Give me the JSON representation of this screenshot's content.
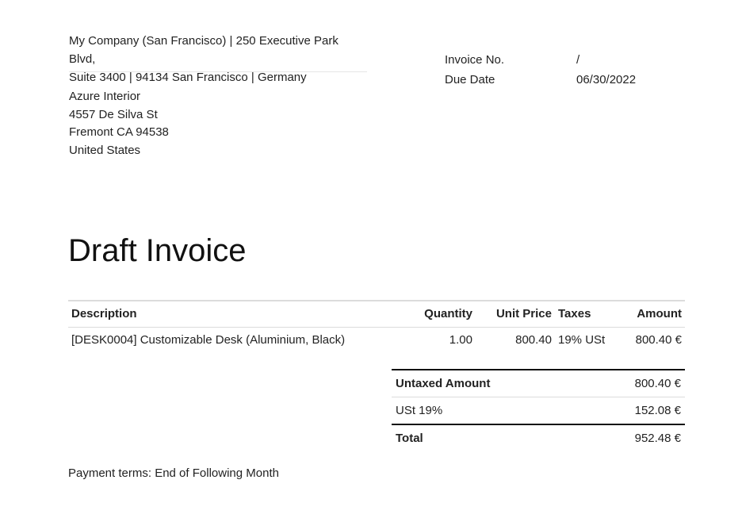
{
  "company": {
    "address_line1": "My Company (San Francisco) | 250 Executive Park Blvd,",
    "address_line2": "Suite 3400 | 94134 San Francisco | Germany"
  },
  "partner": {
    "name": "Azure Interior",
    "street": "4557 De Silva St",
    "city_line": "Fremont CA 94538",
    "country": "United States"
  },
  "meta": {
    "invoice_no_label": "Invoice No.",
    "invoice_no_value": "/",
    "due_date_label": "Due Date",
    "due_date_value": "06/30/2022"
  },
  "title": "Draft Invoice",
  "lines": {
    "headers": [
      "Description",
      "Quantity",
      "Unit Price",
      "Taxes",
      "Amount"
    ],
    "rows": [
      {
        "description": "[DESK0004] Customizable Desk (Aluminium, Black)",
        "quantity": "1.00",
        "unit_price": "800.40",
        "taxes": "19% USt",
        "amount": "800.40 €"
      }
    ]
  },
  "totals": {
    "untaxed_label": "Untaxed Amount",
    "untaxed_value": "800.40 €",
    "tax_label": "USt 19%",
    "tax_value": "152.08 €",
    "total_label": "Total",
    "total_value": "952.48 €"
  },
  "payment_terms": "Payment terms: End of Following Month"
}
